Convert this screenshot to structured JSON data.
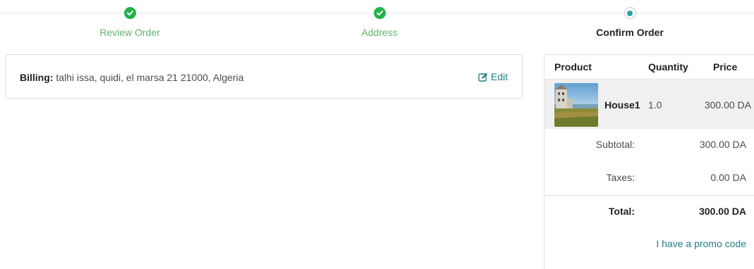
{
  "wizard": {
    "steps": [
      {
        "label": "Review Order",
        "state": "done"
      },
      {
        "label": "Address",
        "state": "done"
      },
      {
        "label": "Confirm Order",
        "state": "current"
      }
    ]
  },
  "billing": {
    "label": "Billing:",
    "address": "talhi issa, quidi, el marsa 21 21000, Algeria",
    "edit_label": "Edit"
  },
  "summary": {
    "headers": {
      "product": "Product",
      "quantity": "Quantity",
      "price": "Price"
    },
    "items": [
      {
        "name": "House1",
        "quantity": "1.0",
        "price": "300.00 DA"
      }
    ],
    "subtotal_label": "Subtotal:",
    "subtotal_value": "300.00 DA",
    "taxes_label": "Taxes:",
    "taxes_value": "0.00 DA",
    "total_label": "Total:",
    "total_value": "300.00 DA",
    "promo_label": "I have a promo code"
  },
  "colors": {
    "done_green": "#21b24a",
    "done_label": "#63b56f",
    "accent_teal": "#217f84",
    "current_dot": "#26a2a6"
  }
}
